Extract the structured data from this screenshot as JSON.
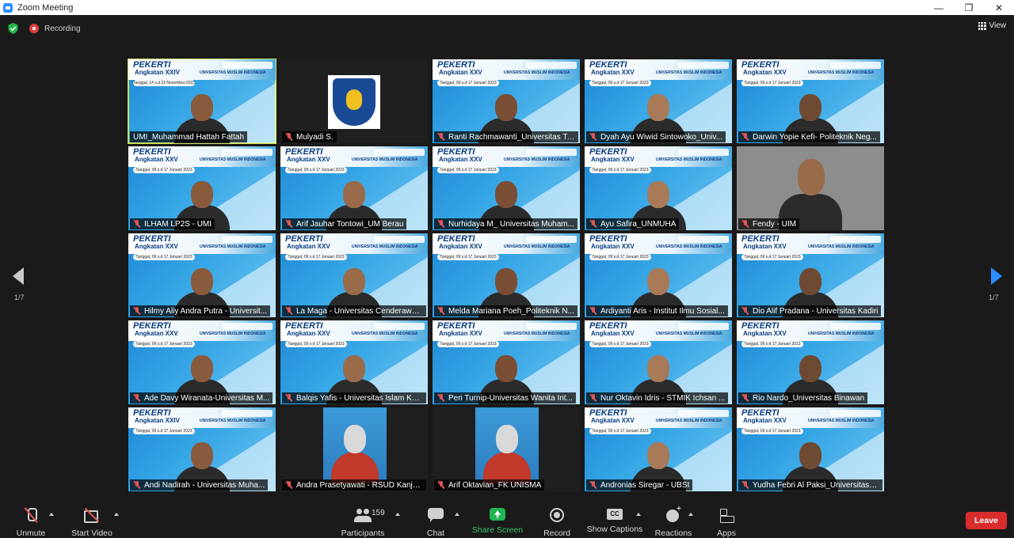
{
  "window": {
    "title": "Zoom Meeting",
    "controls": [
      "minimize-icon",
      "restore-icon",
      "close-icon"
    ]
  },
  "status": {
    "recording_label": "Recording",
    "view_label": "View"
  },
  "banner": {
    "title": "PEKERTI",
    "subtitle_xxiv": "Angkatan XXIV",
    "subtitle_xxv": "Angkatan XXV",
    "date_nov": "Tanggal, 14 s.d 22 November 2022",
    "date_jan": "Tanggal, 09 s.d 17 Januari 2023",
    "university": "UNIVERSITAS MUSLIM INDONESIA"
  },
  "participants": [
    {
      "name": "UMI_Muhammad Hattah Fattah",
      "muted": false
    },
    {
      "name": "Mulyadi S.",
      "muted": true
    },
    {
      "name": "Ranti Rachmawanti_Universitas Te...",
      "muted": true
    },
    {
      "name": "Dyah Ayu Wiwid Sintowoko_Univ...",
      "muted": true
    },
    {
      "name": "Darwin Yopie Kefi- Politeknik Neg...",
      "muted": true
    },
    {
      "name": "ILHAM LP2S - UMI",
      "muted": true
    },
    {
      "name": "Arif Jauhar Tontowi_UM Berau",
      "muted": true
    },
    {
      "name": "Nurhidaya M_ Universitas Muham...",
      "muted": true
    },
    {
      "name": "Ayu Safira_UNMUHA",
      "muted": true
    },
    {
      "name": "Fendy - UIM",
      "muted": true
    },
    {
      "name": "Hilmy Aliy Andra Putra - Universit...",
      "muted": true
    },
    {
      "name": "La Maga - Universitas Cenderawas...",
      "muted": true
    },
    {
      "name": "Melda Mariana Poeh_Politeknik N...",
      "muted": true
    },
    {
      "name": "Ardiyanti Aris - Institut Ilmu Sosial...",
      "muted": true
    },
    {
      "name": "Dio Alif Pradana - Universitas Kadiri",
      "muted": true
    },
    {
      "name": "Ade Davy Wiranata-Universitas M...",
      "muted": true
    },
    {
      "name": "Balqis Yafis - Universitas Islam Keb...",
      "muted": true
    },
    {
      "name": "Peri Turnip-Universitas Wanita Int...",
      "muted": true
    },
    {
      "name": "Nur Oktavin Idris - STMIK Ichsan ...",
      "muted": true
    },
    {
      "name": "Rio Nardo_Universitas Binawan",
      "muted": true
    },
    {
      "name": "Andi Nadirah - Universitas Muha...",
      "muted": true
    },
    {
      "name": "Andra Prasetyawati - RSUD Kanjur...",
      "muted": true
    },
    {
      "name": "Arif Oktavian_FK UNISMA",
      "muted": true
    },
    {
      "name": "Andronias Siregar - UBSI",
      "muted": true
    },
    {
      "name": "Yudha Febri Al Paksi_Universitas B...",
      "muted": true
    }
  ],
  "pagination": {
    "left": "1/7",
    "right": "1/7"
  },
  "toolbar": {
    "unmute": "Unmute",
    "start_video": "Start Video",
    "participants": "Participants",
    "participants_count": "159",
    "chat": "Chat",
    "share_screen": "Share Screen",
    "record": "Record",
    "show_captions": "Show Captions",
    "cc_badge": "CC",
    "reactions": "Reactions",
    "apps": "Apps",
    "leave": "Leave"
  },
  "colors": {
    "background": "#1a1a1a",
    "active_speaker_border": "#c7e35a",
    "share_green": "#20b553",
    "leave_red": "#d92c2c",
    "nav_blue": "#2d8cff"
  }
}
